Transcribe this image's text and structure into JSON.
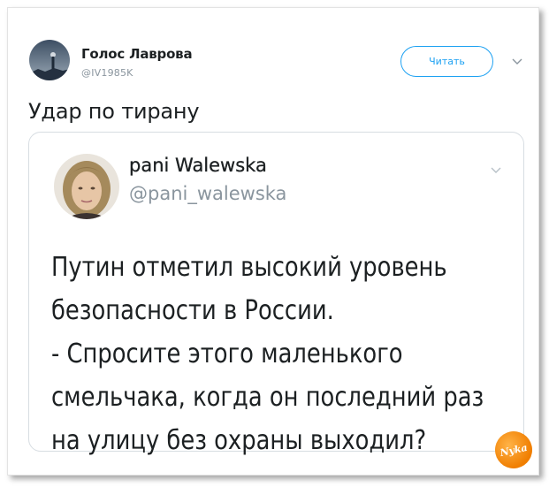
{
  "author": {
    "name": "Голос Лаврова",
    "handle": "@IV1985K",
    "follow_label": "Читать"
  },
  "tweet": {
    "text": "Удар по тирану"
  },
  "quoted_tweet": {
    "name": "pani Walewska",
    "handle": "@pani_walewska",
    "lines": [
      "Путин отметил высокий уровень",
      "безопасности в России.",
      "- Спросите этого маленького",
      "смельчака, когда он последний раз",
      "на улицу без охраны выходил?"
    ]
  },
  "watermark": {
    "text": "Nyka"
  },
  "icons": [
    "user-avatar",
    "chevron-down-icon",
    "watermark-logo"
  ],
  "colors": {
    "accent": "#1da1f2",
    "text": "#1c2022",
    "muted": "#8a959e",
    "border": "#d7dde2",
    "logo": "#f07e00"
  }
}
